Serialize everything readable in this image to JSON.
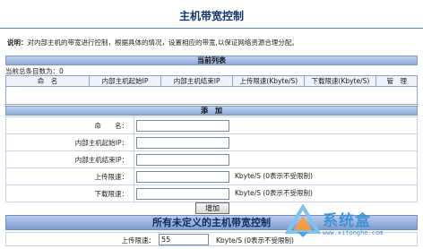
{
  "page": {
    "title": "主机带宽控制"
  },
  "description": {
    "label": "说明：",
    "text": "对内部主机的带宽进行控制，根据具体的情况，设置相应的带宽,以保证网络资源合理分配。"
  },
  "current_list": {
    "section_title": "当前列表",
    "count_label": "当前总条目数为：",
    "count_value": "0",
    "columns": [
      "命　名",
      "内部主机起始IP",
      "内部主机结束IP",
      "上传限速(Kbyte/S)",
      "下载限速(Kbyte/S)",
      "管　理"
    ]
  },
  "add_form": {
    "section_title": "添　加",
    "name_label": "命　　名：",
    "start_ip_label": "内部主机起始IP：",
    "end_ip_label": "内部主机结束IP：",
    "upload_label": "上传限速：",
    "download_label": "下载限速：",
    "upload_unit": "Kbyte/S (0表示不受限制)",
    "download_unit": "Kbyte/S (0表示不受限制)",
    "submit_label": "增加"
  },
  "undefined_hosts": {
    "section_title": "所有未定义的主机带宽控制",
    "upload_label": "上传限速：",
    "upload_value": "55",
    "upload_unit": "Kbyte/S (0表示不受限制)"
  },
  "watermark": {
    "text": "系统盒",
    "url": "www.xitonghe.com",
    "color": "#3f92d8"
  }
}
